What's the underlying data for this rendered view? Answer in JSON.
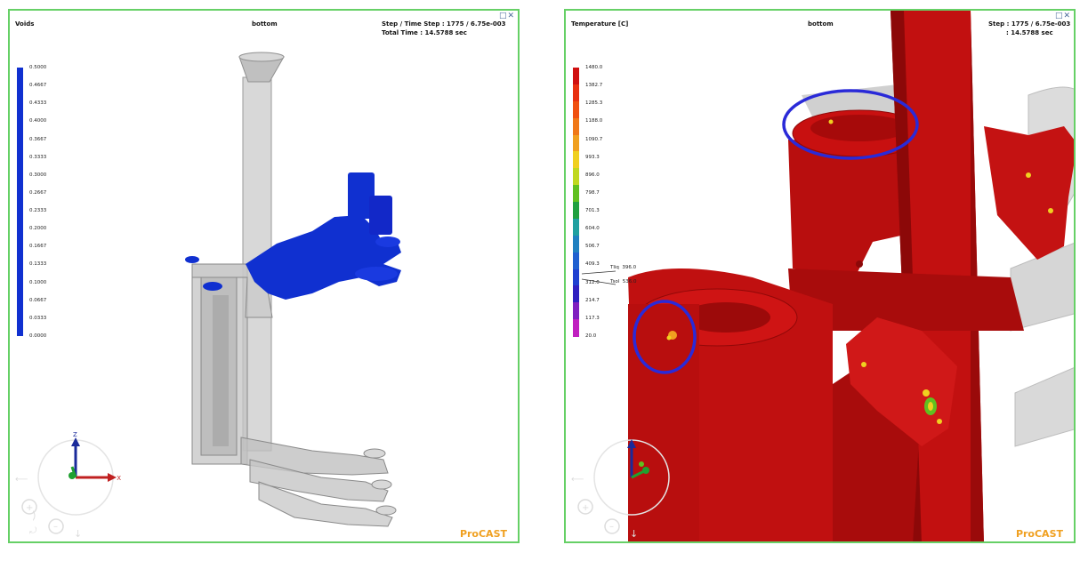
{
  "left_panel": {
    "quantity": "Voids",
    "view": "bottom",
    "step_label": "Step / Time",
    "step_value": "Step : 1775 / 6.75e-003",
    "total_label": "Total  Time",
    "total_value": ": 14.5788  sec",
    "window_controls": "□✕",
    "legend_color": "#1030d0",
    "legend_ticks": [
      "0.5000",
      "0.4667",
      "0.4333",
      "0.4000",
      "0.3667",
      "0.3333",
      "0.3000",
      "0.2667",
      "0.2333",
      "0.2000",
      "0.1667",
      "0.1333",
      "0.1000",
      "0.0667",
      "0.0333",
      "0.0000"
    ],
    "axis_z": "Z",
    "axis_x": "X",
    "brand": "ProCAST"
  },
  "right_panel": {
    "quantity": "Temperature [C]",
    "view": "bottom",
    "step_value": "Step : 1775 / 6.75e-003",
    "total_value": ": 14.5788  sec",
    "window_controls": "□✕",
    "legend_ticks": [
      "1480.0",
      "1382.7",
      "1285.3",
      "1188.0",
      "1090.7",
      "993.3",
      "896.0",
      "798.7",
      "701.3",
      "604.0",
      "506.7",
      "409.3",
      "312.0",
      "214.7",
      "117.3",
      "20.0"
    ],
    "legend_colors": [
      "#d01010",
      "#e83010",
      "#f05010",
      "#f07818",
      "#f0a020",
      "#f0d020",
      "#c0d820",
      "#60c020",
      "#20a040",
      "#20a0a0",
      "#2080c0",
      "#2060d0",
      "#2040d0",
      "#3020c0",
      "#8020c0",
      "#c020c0"
    ],
    "probe_tsq_label": "Tliq",
    "probe_tsq_value": "396.0",
    "probe_tsol_label": "Tsol",
    "probe_tsol_value": "536.0",
    "brand": "ProCAST"
  }
}
